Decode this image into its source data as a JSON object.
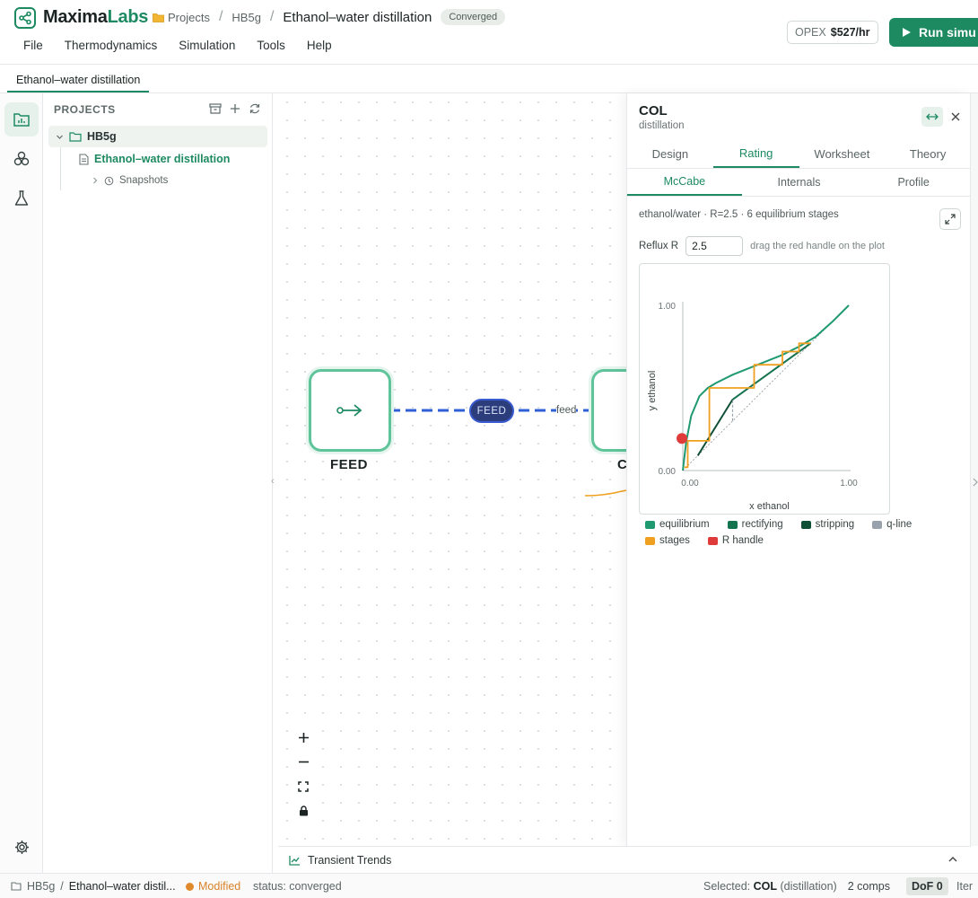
{
  "header": {
    "brand_part1": "Maxima",
    "brand_part2": "Labs",
    "breadcrumb": {
      "projects": "Projects",
      "project": "HB5g",
      "document": "Ethanol–water distillation",
      "status_badge": "Converged"
    },
    "menu": [
      "File",
      "Thermodynamics",
      "Simulation",
      "Tools",
      "Help"
    ],
    "opex_label": "OPEX",
    "opex_value": "$527/hr",
    "run_label": "Run simu"
  },
  "doc_tab": "Ethanol–water distillation",
  "sidebar": {
    "title": "PROJECTS",
    "root": "HB5g",
    "file": "Ethanol–water distillation",
    "snapshots": "Snapshots"
  },
  "canvas": {
    "node_feed_label": "FEED",
    "node_col_label": "C",
    "stream_pill": "FEED",
    "stream_label": "feed"
  },
  "trends_label": "Transient Trends",
  "statusbar": {
    "project": "HB5g",
    "document": "Ethanol–water distil...",
    "modified": "Modified",
    "status": "status: converged",
    "selected_label": "Selected:",
    "selected_name": "COL",
    "selected_type": "(distillation)",
    "comps": "2 comps",
    "dof": "DoF 0",
    "iter": "Iter"
  },
  "panel": {
    "title": "COL",
    "subtitle": "distillation",
    "tabs": [
      "Design",
      "Rating",
      "Worksheet",
      "Theory"
    ],
    "active_tab": 1,
    "subtabs": [
      "McCabe",
      "Internals",
      "Profile"
    ],
    "active_subtab": 0,
    "summary": "ethanol/water · R=2.5 · 6 equilibrium stages",
    "reflux_label": "Reflux R",
    "reflux_value": "2.5",
    "reflux_hint": "drag the red handle on the plot"
  },
  "colors": {
    "accent": "#1d8a62",
    "equilibrium": "#1f9970",
    "rectifying": "#16734f",
    "stripping": "#0f4f36",
    "qline": "#98a2ad",
    "stages": "#f0a020",
    "handle": "#e03b3b"
  },
  "chart_data": {
    "type": "line",
    "title": "",
    "xlabel": "x ethanol",
    "ylabel": "y ethanol",
    "xlim": [
      0,
      1
    ],
    "ylim": [
      0,
      1
    ],
    "x_ticks": [
      "0.00",
      "1.00"
    ],
    "y_ticks": [
      "0.00",
      "1.00"
    ],
    "legend": [
      "equilibrium",
      "rectifying",
      "stripping",
      "q-line",
      "stages",
      "R handle"
    ],
    "series": [
      {
        "name": "equilibrium",
        "x": [
          0,
          0.02,
          0.05,
          0.1,
          0.15,
          0.2,
          0.3,
          0.4,
          0.5,
          0.6,
          0.7,
          0.8,
          0.9,
          1.0
        ],
        "y": [
          0,
          0.17,
          0.33,
          0.45,
          0.5,
          0.53,
          0.58,
          0.62,
          0.66,
          0.7,
          0.75,
          0.81,
          0.9,
          1.0
        ]
      },
      {
        "name": "rectifying",
        "x": [
          0.3,
          0.77
        ],
        "y": [
          0.43,
          0.77
        ]
      },
      {
        "name": "stripping",
        "x": [
          0.09,
          0.3
        ],
        "y": [
          0.09,
          0.43
        ]
      },
      {
        "name": "q-line",
        "x": [
          0.3,
          0.3
        ],
        "y": [
          0.3,
          0.43
        ]
      },
      {
        "name": "stages",
        "x": [
          0.77,
          0.7,
          0.7,
          0.6,
          0.6,
          0.43,
          0.43,
          0.16,
          0.16,
          0.03,
          0.03,
          0.01
        ],
        "y": [
          0.77,
          0.77,
          0.72,
          0.72,
          0.64,
          0.64,
          0.5,
          0.5,
          0.18,
          0.18,
          0.02,
          0.02
        ]
      },
      {
        "name": "R handle",
        "x": [
          0
        ],
        "y": [
          0.2
        ]
      }
    ]
  }
}
